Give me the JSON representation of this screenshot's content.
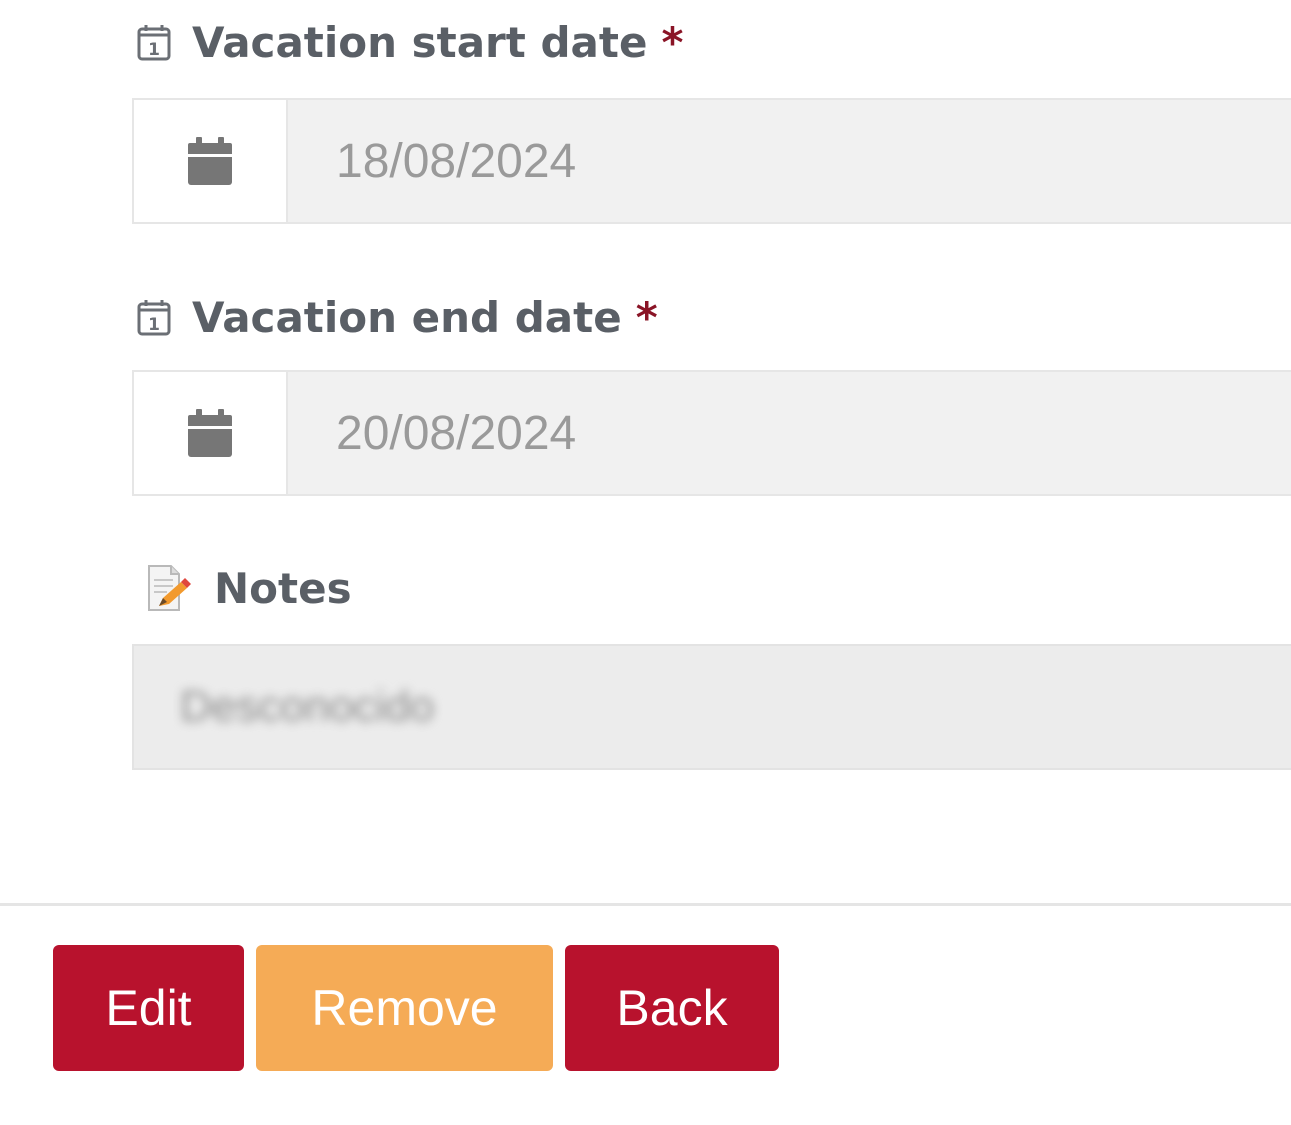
{
  "form": {
    "start_date": {
      "label": "Vacation start date",
      "required_mark": "*",
      "value": "18/08/2024",
      "icon": "calendar-day-icon",
      "addon_icon": "calendar-icon"
    },
    "end_date": {
      "label": "Vacation end date",
      "required_mark": "*",
      "value": "20/08/2024",
      "icon": "calendar-day-icon",
      "addon_icon": "calendar-icon"
    },
    "notes": {
      "label": "Notes",
      "icon": "memo-icon",
      "value": "Desconocido"
    }
  },
  "actions": {
    "edit_label": "Edit",
    "remove_label": "Remove",
    "back_label": "Back"
  },
  "colors": {
    "primary": "#b8122d",
    "warning": "#f5ab56",
    "label_text": "#5a5f66",
    "required": "#8a1426"
  }
}
